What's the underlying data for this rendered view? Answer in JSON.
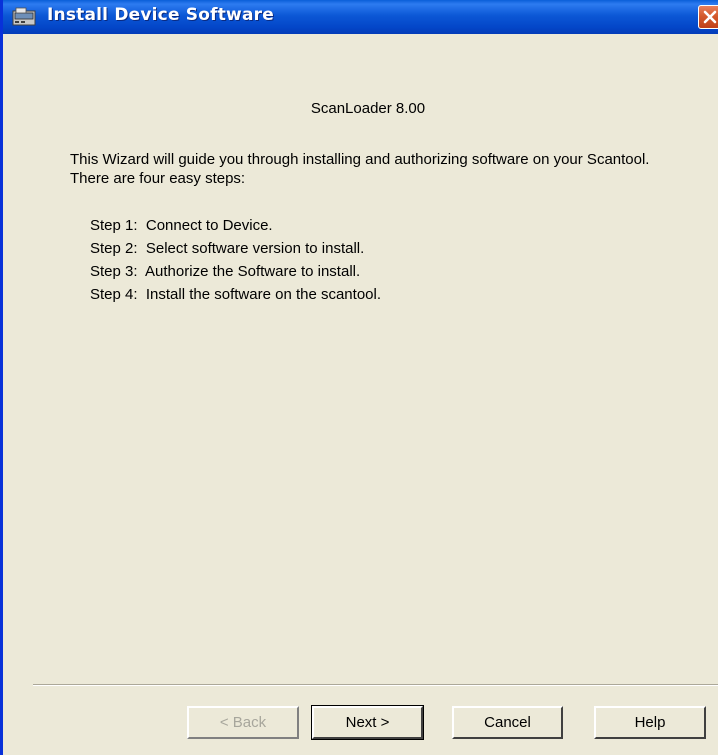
{
  "window": {
    "title": "Install Device Software",
    "title_icon": "installer-window-icon",
    "close_icon": "close-icon"
  },
  "content": {
    "product_title": "ScanLoader 8.00",
    "intro": "This Wizard will guide you through installing and authorizing software on your Scantool.  There are four easy steps:",
    "steps": [
      "Step 1:  Connect to Device.",
      "Step 2:  Select software version to install.",
      "Step 3:  Authorize the Software to install.",
      "Step 4:  Install the software on the scantool."
    ]
  },
  "buttons": {
    "back": {
      "label": "< Back",
      "enabled": false
    },
    "next": {
      "label": "Next >",
      "enabled": true,
      "default": true
    },
    "cancel": {
      "label": "Cancel",
      "enabled": true
    },
    "help": {
      "label": "Help",
      "enabled": true
    }
  },
  "colors": {
    "titlebar": "#0a5fd8",
    "dialog_background": "#ece9d8",
    "close_button": "#d45a2c",
    "disabled_text": "#a7a69c"
  }
}
